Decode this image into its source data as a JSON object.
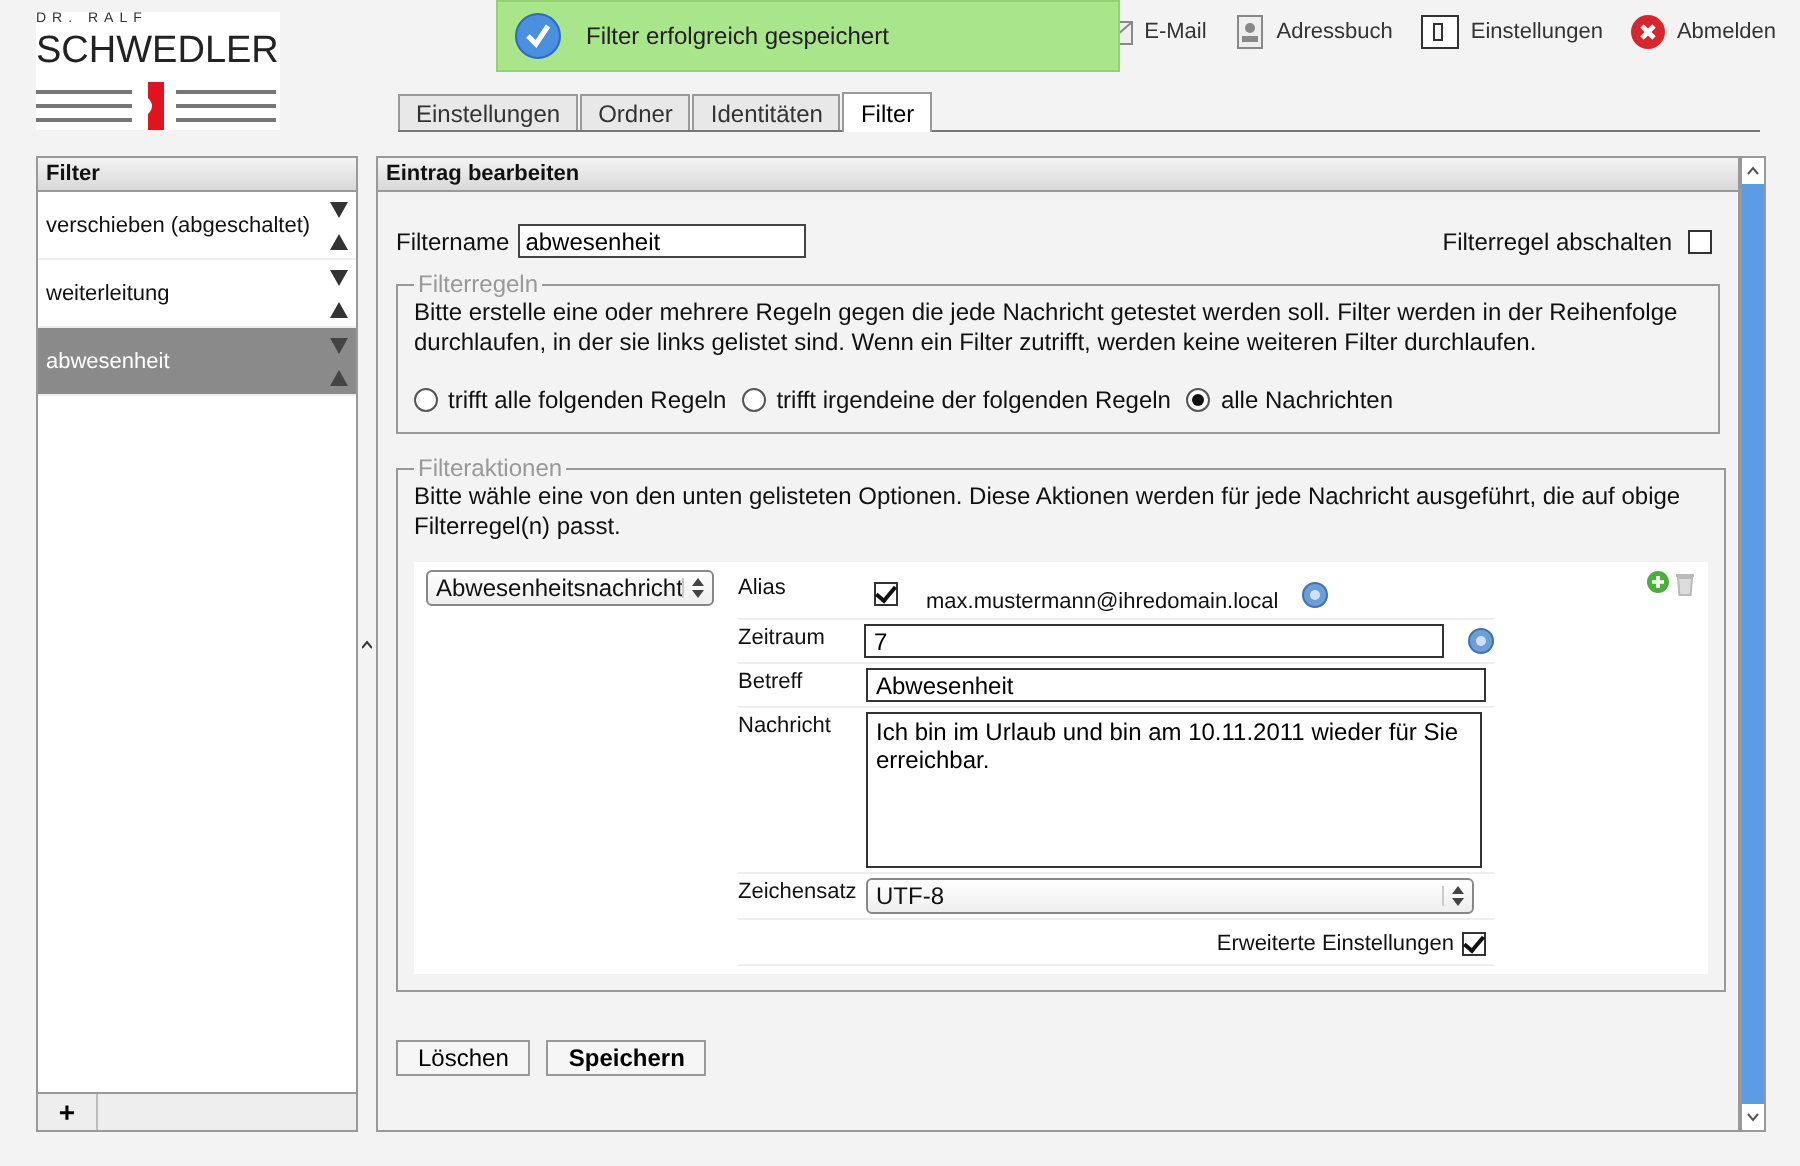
{
  "logo": {
    "top_line": "DR. RALF",
    "name": "SCHWEDLER"
  },
  "notification": {
    "text": "Filter erfolgreich gespeichert"
  },
  "nav": [
    {
      "label": "E-Mail",
      "kind": "mail"
    },
    {
      "label": "Adressbuch",
      "kind": "addressbook"
    },
    {
      "label": "Einstellungen",
      "kind": "settings"
    },
    {
      "label": "Abmelden",
      "kind": "logout"
    }
  ],
  "tabs": [
    {
      "label": "Einstellungen",
      "selected": false
    },
    {
      "label": "Ordner",
      "selected": false
    },
    {
      "label": "Identitäten",
      "selected": false
    },
    {
      "label": "Filter",
      "selected": true
    }
  ],
  "filter_list": {
    "title": "Filter",
    "add_button": "+",
    "items": [
      {
        "name": "verschieben (abgeschaltet)",
        "selected": false
      },
      {
        "name": "weiterleitung",
        "selected": false
      },
      {
        "name": "abwesenheit",
        "selected": true
      }
    ]
  },
  "editor": {
    "title": "Eintrag bearbeiten",
    "filtername_label": "Filtername",
    "filtername_value": "abwesenheit",
    "disable_label": "Filterregel abschalten",
    "disable_checked": false,
    "rules": {
      "legend": "Filterregeln",
      "description": "Bitte erstelle eine oder mehrere Regeln gegen die jede Nachricht getestet werden soll. Filter werden in der Reihenfolge durchlaufen, in der sie links gelistet sind. Wenn ein Filter zutrifft, werden keine weiteren Filter durchlaufen.",
      "options": [
        {
          "label": "trifft alle folgenden Regeln",
          "selected": false
        },
        {
          "label": "trifft irgendeine der folgenden Regeln",
          "selected": false
        },
        {
          "label": "alle Nachrichten",
          "selected": true
        }
      ]
    },
    "actions": {
      "legend": "Filteraktionen",
      "description": "Bitte wähle eine von den unten gelisteten Optionen. Diese Aktionen werden für jede Nachricht ausgeführt, die auf obige Filterregel(n) passt.",
      "action_select": "Abwesenheitsnachricht",
      "fields": [
        {
          "kind": "checkbox",
          "label": "Alias",
          "value": "max.mustermann@ihredomain.local",
          "checked": true,
          "help": true
        },
        {
          "kind": "input",
          "label": "Zeitraum",
          "value": "7",
          "help": true
        },
        {
          "kind": "input",
          "label": "Betreff",
          "value": "Abwesenheit",
          "help": false
        },
        {
          "kind": "textarea",
          "label": "Nachricht",
          "value": "Ich bin im Urlaub und bin am 10.11.2011 wieder für Sie erreichbar.",
          "help": false
        },
        {
          "kind": "select",
          "label": "Zeichensatz",
          "value": "UTF-8",
          "help": false
        }
      ],
      "advanced_label": "Erweiterte Einstellungen",
      "advanced_checked": true
    },
    "buttons": [
      {
        "label": "Löschen",
        "primary": false
      },
      {
        "label": "Speichern",
        "primary": true
      }
    ]
  }
}
